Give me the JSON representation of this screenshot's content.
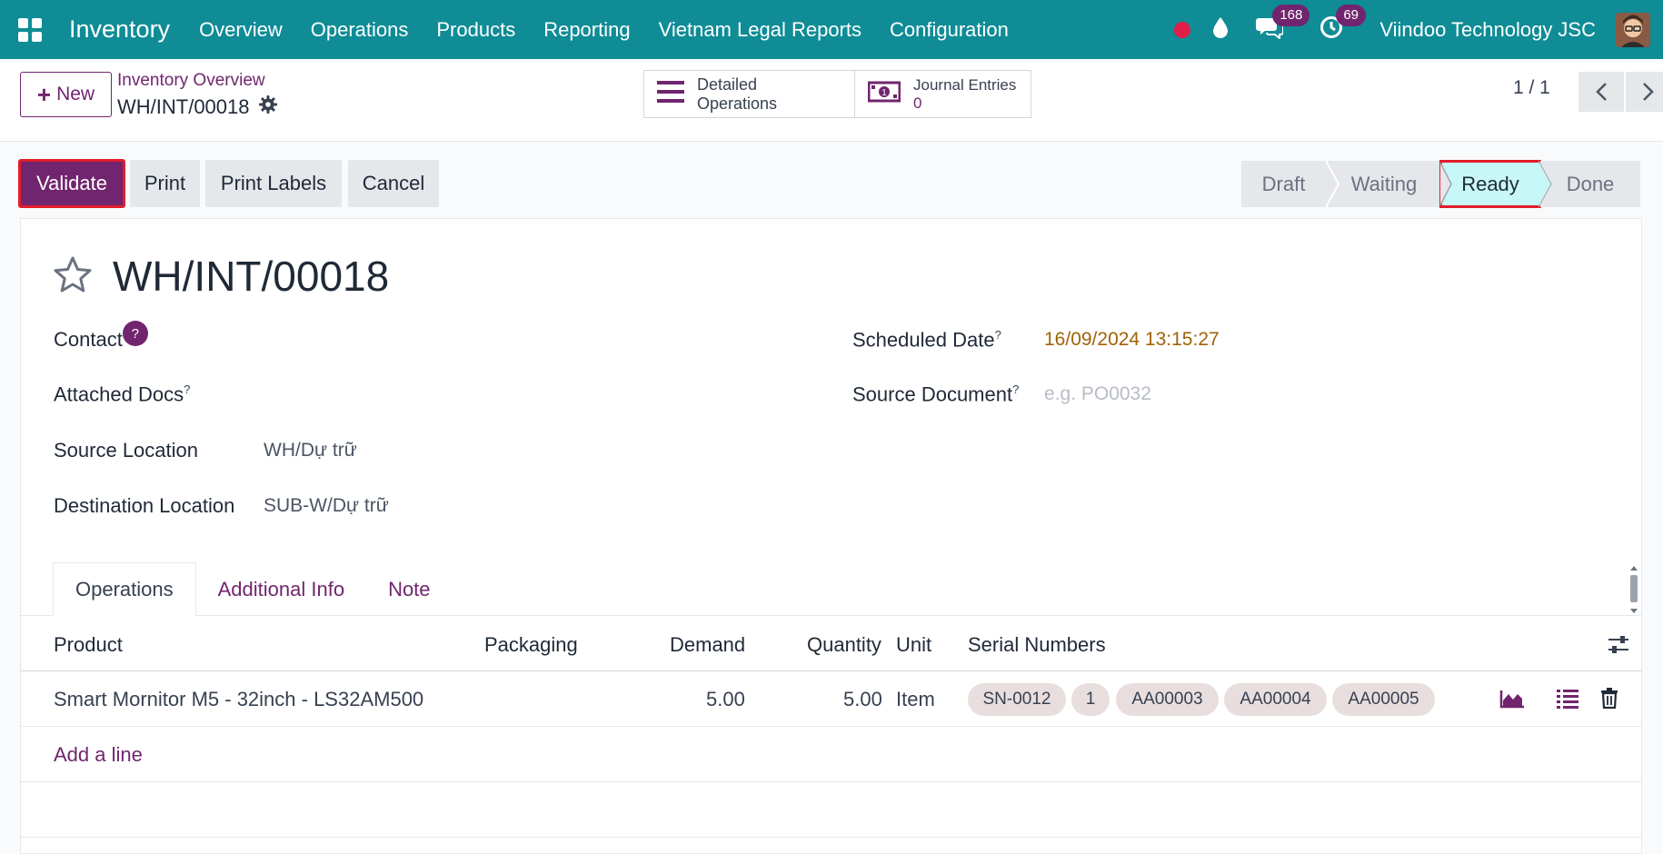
{
  "topbar": {
    "app_name": "Inventory",
    "menu": [
      "Overview",
      "Operations",
      "Products",
      "Reporting",
      "Vietnam Legal Reports",
      "Configuration"
    ],
    "messages_count": "168",
    "activities_count": "69",
    "company": "Viindoo Technology JSC",
    "colors": {
      "bar": "#0f8c96",
      "badge": "#71256e"
    }
  },
  "control": {
    "new_label": "New",
    "breadcrumb_parent": "Inventory Overview",
    "breadcrumb_current": "WH/INT/00018",
    "detailed_operations_label": "Detailed Operations",
    "journal_entries_label": "Journal Entries",
    "journal_entries_count": "0",
    "pager": "1 / 1"
  },
  "actions": {
    "validate": "Validate",
    "print": "Print",
    "print_labels": "Print Labels",
    "cancel": "Cancel"
  },
  "status": {
    "stages": [
      "Draft",
      "Waiting",
      "Ready",
      "Done"
    ],
    "current": "Ready"
  },
  "record": {
    "title": "WH/INT/00018",
    "fields": {
      "contact_label": "Contact",
      "contact_help": "?",
      "attached_docs_label": "Attached Docs",
      "source_location_label": "Source Location",
      "source_location_value": "WH/Dự trữ",
      "destination_location_label": "Destination Location",
      "destination_location_value": "SUB-W/Dự trữ",
      "scheduled_date_label": "Scheduled Date",
      "scheduled_date_value": "16/09/2024 13:15:27",
      "source_document_label": "Source Document",
      "source_document_placeholder": "e.g. PO0032",
      "help_mark": "?"
    },
    "tabs": [
      "Operations",
      "Additional Info",
      "Note"
    ],
    "table": {
      "headers": [
        "Product",
        "Packaging",
        "Demand",
        "Quantity",
        "Unit",
        "Serial Numbers"
      ],
      "rows": [
        {
          "product": "Smart Mornitor M5 - 32inch - LS32AM500",
          "packaging": "",
          "demand": "5.00",
          "quantity": "5.00",
          "unit": "Item",
          "serials": [
            "SN-0012",
            "1",
            "AA00003",
            "AA00004",
            "AA00005"
          ]
        }
      ],
      "add_line": "Add a line"
    }
  }
}
